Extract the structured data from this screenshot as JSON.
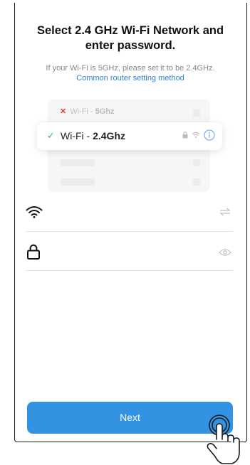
{
  "title": "Select 2.4 GHz Wi-Fi Network and enter password.",
  "subtitle": "If your Wi-Fi is 5GHz, please set it to be 2.4GHz.",
  "router_link": "Common router setting method",
  "illustration": {
    "wifi_5": {
      "prefix": "Wi-Fi - ",
      "band": "5Ghz"
    },
    "wifi_24": {
      "prefix": "Wi-Fi - ",
      "band": "2.4Ghz"
    }
  },
  "wifi_field": {
    "icon": "wifi-icon",
    "action_icon": "swap-icon"
  },
  "password_field": {
    "icon": "lock-icon",
    "action_icon": "eye-icon"
  },
  "next_label": "Next",
  "colors": {
    "accent": "#3393e3",
    "link": "#2f7fd6",
    "check": "#3bb86a",
    "error": "#e23b3b"
  }
}
